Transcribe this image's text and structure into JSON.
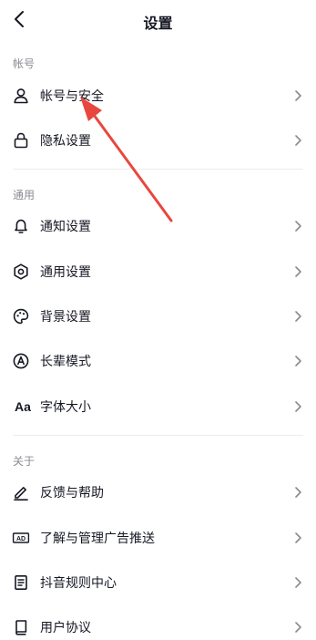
{
  "header": {
    "title": "设置"
  },
  "sections": {
    "account": "帐号",
    "general": "通用",
    "about": "关于"
  },
  "items": {
    "account_security": {
      "label": "帐号与安全",
      "icon": "person-icon"
    },
    "privacy": {
      "label": "隐私设置",
      "icon": "lock-icon"
    },
    "notifications": {
      "label": "通知设置",
      "icon": "bell-icon"
    },
    "general_settings": {
      "label": "通用设置",
      "icon": "gear-icon"
    },
    "background": {
      "label": "背景设置",
      "icon": "palette-icon"
    },
    "elder_mode": {
      "label": "长辈模式",
      "icon": "elder-mode-icon"
    },
    "font_size": {
      "label": "字体大小",
      "icon": "font-size-icon",
      "icon_text": "Aa"
    },
    "feedback": {
      "label": "反馈与帮助",
      "icon": "edit-pen-icon"
    },
    "ads": {
      "label": "了解与管理广告推送",
      "icon": "ad-icon",
      "icon_text": "AD"
    },
    "rules": {
      "label": "抖音规则中心",
      "icon": "document-icon"
    },
    "user_agreement": {
      "label": "用户协议",
      "icon": "book-icon"
    }
  },
  "annotation": {
    "color": "#e8473e"
  }
}
